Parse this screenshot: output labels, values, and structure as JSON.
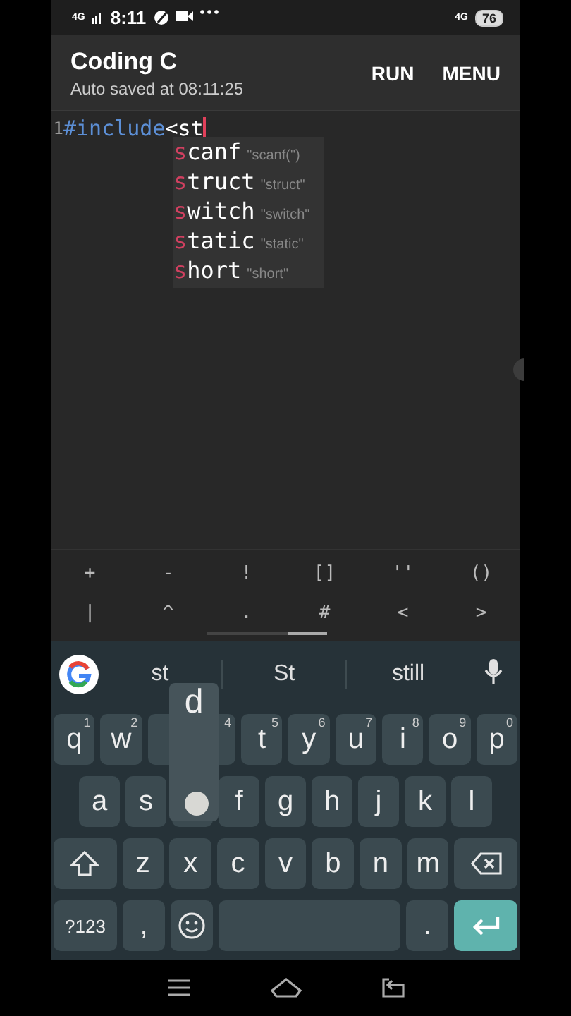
{
  "status_bar": {
    "network": "4G",
    "time": "8:11",
    "network_right": "4G",
    "battery": "76"
  },
  "app_bar": {
    "title": "Coding C",
    "subtitle": "Auto saved at 08:11:25",
    "actions": [
      "RUN",
      "MENU"
    ]
  },
  "editor": {
    "line_number": "1",
    "keyword": "#include",
    "text": "<st",
    "completions": [
      {
        "match": "s",
        "rest": "canf",
        "hint": "\"scanf(\")"
      },
      {
        "match": "s",
        "rest": "truct",
        "hint": "\"struct\""
      },
      {
        "match": "s",
        "rest": "witch",
        "hint": "\"switch\""
      },
      {
        "match": "s",
        "rest": "tatic",
        "hint": "\"static\""
      },
      {
        "match": "s",
        "rest": "hort",
        "hint": "\"short\""
      }
    ]
  },
  "symbol_bar": {
    "rows": [
      [
        "+",
        "-",
        "!",
        "[]",
        "''",
        "()"
      ],
      [
        "|",
        "^",
        ".",
        "#",
        "<",
        ">"
      ]
    ]
  },
  "keyboard": {
    "suggestions": [
      "st",
      "St",
      "still"
    ],
    "rows": [
      {
        "keys": [
          {
            "kind": "letter",
            "label": "q",
            "hint": "1"
          },
          {
            "kind": "letter",
            "label": "w",
            "hint": "2"
          },
          {
            "kind": "covered"
          },
          {
            "kind": "covered",
            "hint": "4"
          },
          {
            "kind": "letter",
            "label": "t",
            "hint": "5"
          },
          {
            "kind": "letter",
            "label": "y",
            "hint": "6"
          },
          {
            "kind": "letter",
            "label": "u",
            "hint": "7"
          },
          {
            "kind": "letter",
            "label": "i",
            "hint": "8"
          },
          {
            "kind": "letter",
            "label": "o",
            "hint": "9"
          },
          {
            "kind": "letter",
            "label": "p",
            "hint": "0"
          }
        ]
      },
      {
        "keys": [
          {
            "kind": "letter",
            "label": "a"
          },
          {
            "kind": "letter",
            "label": "s"
          },
          {
            "kind": "covered"
          },
          {
            "kind": "letter",
            "label": "f"
          },
          {
            "kind": "letter",
            "label": "g"
          },
          {
            "kind": "letter",
            "label": "h"
          },
          {
            "kind": "letter",
            "label": "j"
          },
          {
            "kind": "letter",
            "label": "k"
          },
          {
            "kind": "letter",
            "label": "l"
          }
        ]
      },
      {
        "keys": [
          {
            "kind": "shift"
          },
          {
            "kind": "letter",
            "label": "z"
          },
          {
            "kind": "letter",
            "label": "x"
          },
          {
            "kind": "letter",
            "label": "c"
          },
          {
            "kind": "letter",
            "label": "v"
          },
          {
            "kind": "letter",
            "label": "b"
          },
          {
            "kind": "letter",
            "label": "n"
          },
          {
            "kind": "letter",
            "label": "m"
          },
          {
            "kind": "backspace"
          }
        ]
      },
      {
        "keys": [
          {
            "kind": "mode",
            "label": "?123"
          },
          {
            "kind": "letter",
            "label": ","
          },
          {
            "kind": "emoji"
          },
          {
            "kind": "space"
          },
          {
            "kind": "letter",
            "label": "."
          },
          {
            "kind": "enter"
          }
        ]
      }
    ],
    "popup": {
      "label": "d"
    }
  }
}
